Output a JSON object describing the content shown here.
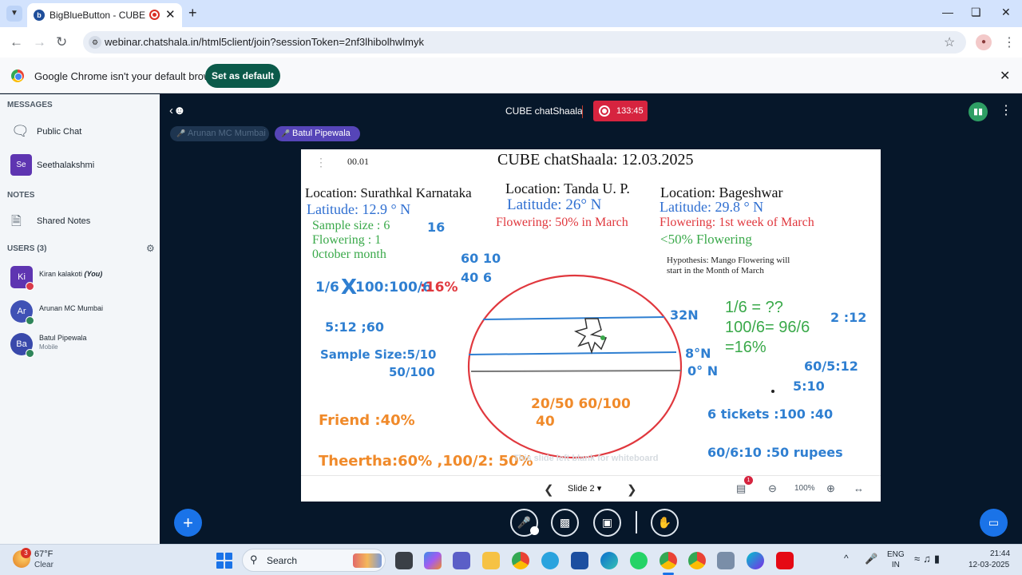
{
  "browser": {
    "tab_title": "BigBlueButton - CUBE chatShaala",
    "url": "webinar.chatshala.in/html5client/join?sessionToken=2nf3lhibolhwlmyk",
    "infobar_text": "Google Chrome isn't your default browser",
    "set_default_label": "Set as default"
  },
  "sidebar": {
    "messages_heading": "MESSAGES",
    "public_chat": "Public Chat",
    "private_chat": {
      "initials": "Se",
      "name": "Seethalakshmi"
    },
    "notes_heading": "NOTES",
    "shared_notes": "Shared Notes",
    "users_heading": "USERS (3)",
    "users": [
      {
        "initials": "Ki",
        "name": "Kiran kalakoti",
        "tag": "(You)",
        "sub": "",
        "color": "#5e35b1"
      },
      {
        "initials": "Ar",
        "name": "Arunan MC Mumbai",
        "tag": "",
        "sub": "",
        "color": "#3f51b5"
      },
      {
        "initials": "Ba",
        "name": "Batul Pipewala",
        "tag": "",
        "sub": "Mobile",
        "color": "#3949ab"
      }
    ]
  },
  "meeting": {
    "title": "CUBE chatShaala",
    "recording_time": "133:45",
    "talkers": [
      "Arunan MC Mumbai",
      "Batul Pipewala"
    ]
  },
  "slide": {
    "counter": "00.01",
    "title": "CUBE chatShaala: 12.03.2025",
    "loc1": {
      "location": "Location: Surathkal Karnataka",
      "latitude": "Latitude: 12.9 ° N",
      "sample": "Sample size : 6",
      "flowering": "Flowering : 1",
      "month": "0ctober month"
    },
    "loc2": {
      "location": "Location: Tanda U. P.",
      "latitude": "Latitude:  26° N",
      "flowering": "Flowering:  50% in March"
    },
    "loc3": {
      "location": "Location: Bageshwar",
      "latitude": "Latitude: 29.8 ° N",
      "flowering": "Flowering: 1st week of March",
      "percent": "<50% Flowering"
    },
    "hypothesis_line1": "Hypothesis: Mango Flowering will",
    "hypothesis_line2": "start in the Month of March",
    "hand": {
      "n16": "16",
      "n60_10": "60  10",
      "n40_6": "40  6",
      "calc_a": "1/6",
      "calc_x": "X",
      "calc_b": "100:100/6",
      "calc_c": ":16%",
      "ratio_512": "5:12 ;60",
      "sample_size": "Sample Size:5/10",
      "fifty_100": "50/100",
      "friend": "Friend :40%",
      "theertha": "Theertha:60%  ,100/2: 50%",
      "lat32": "32N",
      "lat8": "8°N",
      "lat0": "0° N",
      "frac_20_50": "20/50   60/100",
      "n40": "40",
      "green1": "1/6 = ??",
      "green2": "100/6= 96/6",
      "green3": "=16%",
      "r2_12": "2 :12",
      "r60_5": "60/5:12",
      "r5_10": "5:10",
      "tickets": "6 tickets :100  :40",
      "rupees": "60/6:10   :50 rupees"
    },
    "watermark": "This slide left blank for whiteboard",
    "footer": {
      "slide_label": "Slide 2",
      "zoom": "100%",
      "annotations_badge": "1"
    }
  },
  "taskbar": {
    "weather_badge": "3",
    "temperature": "67°F",
    "weather": "Clear",
    "search_label": "Search",
    "lang_line1": "ENG",
    "lang_line2": "IN",
    "time": "21:44",
    "date": "12-03-2025"
  },
  "colors": {
    "accent": "#1a73e8",
    "record": "#d6243f",
    "talker_active": "#5645b8",
    "chrome_green": "#0b5a4a"
  }
}
